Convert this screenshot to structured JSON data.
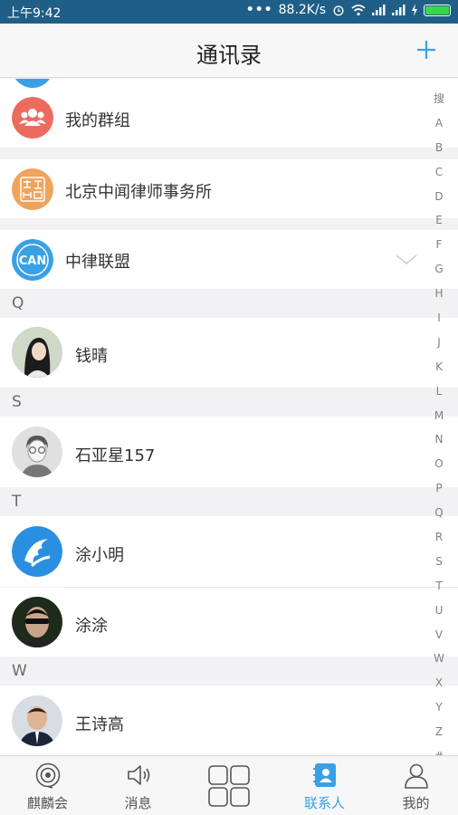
{
  "status_bar": {
    "time": "上午9:42",
    "net_speed": "88.2K/s",
    "battery_color": "#38d84a"
  },
  "header": {
    "title": "通讯录",
    "add_icon": "plus-icon"
  },
  "groups": [
    {
      "label": "我的群组",
      "icon": "group-people-icon",
      "color": "#ec6b5f"
    },
    {
      "label": "北京中闻律师事务所",
      "icon": "law-firm-seal-icon",
      "color": "#efa35c"
    },
    {
      "label": "中律联盟",
      "icon": "can-logo-icon",
      "color": "#3aa0e6",
      "expand_icon": "chevron-down-icon"
    }
  ],
  "sections": [
    {
      "letter": "Q",
      "contacts": [
        {
          "name": "钱晴"
        }
      ]
    },
    {
      "letter": "S",
      "contacts": [
        {
          "name": "石亚星157"
        }
      ]
    },
    {
      "letter": "T",
      "contacts": [
        {
          "name": "涂小明"
        },
        {
          "name": "涂涂"
        }
      ]
    },
    {
      "letter": "W",
      "contacts": [
        {
          "name": "王诗高"
        }
      ]
    }
  ],
  "index_letters": [
    "搜",
    "A",
    "B",
    "C",
    "D",
    "E",
    "F",
    "G",
    "H",
    "I",
    "J",
    "K",
    "L",
    "M",
    "N",
    "O",
    "P",
    "Q",
    "R",
    "S",
    "T",
    "U",
    "V",
    "W",
    "X",
    "Y",
    "Z",
    "#"
  ],
  "tabs": [
    {
      "label": "麒麟会",
      "icon": "eye-ring-icon",
      "active": false
    },
    {
      "label": "消息",
      "icon": "speaker-icon",
      "active": false
    },
    {
      "label": "",
      "icon": "grid-apps-icon",
      "active": false
    },
    {
      "label": "联系人",
      "icon": "contacts-book-icon",
      "active": true
    },
    {
      "label": "我的",
      "icon": "person-icon",
      "active": false
    }
  ],
  "colors": {
    "accent": "#3aa0e6",
    "status_bar": "#1f5e86",
    "section_bg": "#f2f2f4"
  }
}
